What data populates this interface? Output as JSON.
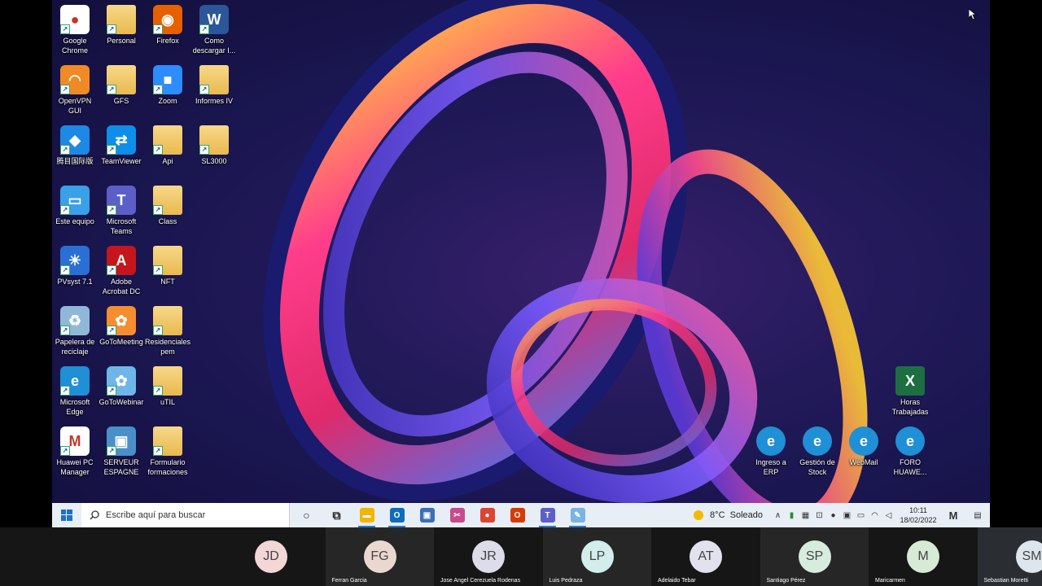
{
  "desktop_icons": [
    {
      "name": "chrome-icon",
      "label": "Google Chrome",
      "col": 0,
      "row": 0,
      "color": "#ffffff",
      "glyph": "●"
    },
    {
      "name": "folder-icon",
      "label": "Personal",
      "col": 1,
      "row": 0,
      "folder": true
    },
    {
      "name": "firefox-icon",
      "label": "Firefox",
      "col": 2,
      "row": 0,
      "color": "#e66000",
      "glyph": "◉"
    },
    {
      "name": "word-doc-icon",
      "label": "Como descargar I...",
      "col": 3,
      "row": 0,
      "color": "#2b579a",
      "glyph": "W"
    },
    {
      "name": "openvpn-icon",
      "label": "OpenVPN GUI",
      "col": 0,
      "row": 1,
      "color": "#f08a24",
      "glyph": "◠"
    },
    {
      "name": "folder-icon",
      "label": "GFS",
      "col": 1,
      "row": 1,
      "folder": true
    },
    {
      "name": "zoom-icon",
      "label": "Zoom",
      "col": 2,
      "row": 1,
      "color": "#2d8cff",
      "glyph": "■"
    },
    {
      "name": "folder-icon",
      "label": "Informes IV",
      "col": 3,
      "row": 1,
      "folder": true
    },
    {
      "name": "app-icon",
      "label": "腾目国际版",
      "col": 0,
      "row": 2,
      "color": "#1e88e5",
      "glyph": "◆"
    },
    {
      "name": "teamviewer-icon",
      "label": "TeamViewer",
      "col": 1,
      "row": 2,
      "color": "#0e8ee9",
      "glyph": "⇄"
    },
    {
      "name": "folder-icon",
      "label": "Api",
      "col": 2,
      "row": 2,
      "folder": true
    },
    {
      "name": "folder-icon",
      "label": "SL3000",
      "col": 3,
      "row": 2,
      "folder": true
    },
    {
      "name": "computer-icon",
      "label": "Este equipo",
      "col": 0,
      "row": 3,
      "color": "#3aa0e8",
      "glyph": "▭"
    },
    {
      "name": "teams-icon",
      "label": "Microsoft Teams",
      "col": 1,
      "row": 3,
      "color": "#5b5fc7",
      "glyph": "T"
    },
    {
      "name": "folder-icon",
      "label": "Class",
      "col": 2,
      "row": 3,
      "folder": true
    },
    {
      "name": "pvsyst-icon",
      "label": "PVsyst 7.1",
      "col": 0,
      "row": 4,
      "color": "#2a6fd6",
      "glyph": "☀"
    },
    {
      "name": "acrobat-icon",
      "label": "Adobe Acrobat DC",
      "col": 1,
      "row": 4,
      "color": "#c4161c",
      "glyph": "A"
    },
    {
      "name": "folder-icon",
      "label": "NFT",
      "col": 2,
      "row": 4,
      "folder": true
    },
    {
      "name": "recycle-bin-icon",
      "label": "Papelera de reciclaje",
      "col": 0,
      "row": 5,
      "color": "#8fb8d8",
      "glyph": "♻"
    },
    {
      "name": "gotomeeting-icon",
      "label": "GoToMeeting",
      "col": 1,
      "row": 5,
      "color": "#f68d2e",
      "glyph": "✿"
    },
    {
      "name": "folder-icon",
      "label": "Residenciales pem",
      "col": 2,
      "row": 5,
      "folder": true
    },
    {
      "name": "edge-icon",
      "label": "Microsoft Edge",
      "col": 0,
      "row": 6,
      "color": "#1f8fd6",
      "glyph": "e"
    },
    {
      "name": "gotowebinar-icon",
      "label": "GoToWebinar",
      "col": 1,
      "row": 6,
      "color": "#6fb6e8",
      "glyph": "✿"
    },
    {
      "name": "folder-icon",
      "label": "uTIL",
      "col": 2,
      "row": 6,
      "folder": true
    },
    {
      "name": "huawei-pc-manager-icon",
      "label": "Huawei PC Manager",
      "col": 0,
      "row": 7,
      "color": "#ffffff",
      "glyph": "M"
    },
    {
      "name": "network-computer-icon",
      "label": "SERVEUR ESPAGNE",
      "col": 1,
      "row": 7,
      "color": "#4a90c8",
      "glyph": "▣"
    },
    {
      "name": "folder-icon",
      "label": "Formulario formaciones",
      "col": 2,
      "row": 7,
      "folder": true
    }
  ],
  "right_icons": [
    {
      "name": "excel-icon",
      "label": "Horas Trabajadas",
      "color": "#1d6f42",
      "glyph": "X"
    },
    {
      "name": "edge-icon",
      "label": "Ingreso a ERP",
      "color": "#1f8fd6",
      "glyph": "e"
    },
    {
      "name": "edge-icon",
      "label": "Gestión de Stock",
      "color": "#1f8fd6",
      "glyph": "e"
    },
    {
      "name": "edge-icon",
      "label": "WebMail",
      "color": "#1f8fd6",
      "glyph": "e"
    },
    {
      "name": "edge-icon",
      "label": "FORO HUAWE...",
      "color": "#1f8fd6",
      "glyph": "e"
    }
  ],
  "taskbar": {
    "search_placeholder": "Escribe aquí para buscar",
    "apps": [
      {
        "name": "cortana-icon",
        "glyph": "○",
        "color": "transparent",
        "fg": "#222"
      },
      {
        "name": "task-view-icon",
        "glyph": "⧉",
        "color": "transparent",
        "fg": "#222"
      },
      {
        "name": "file-explorer-icon",
        "glyph": "▬",
        "color": "#f2b500",
        "active": true
      },
      {
        "name": "outlook-icon",
        "glyph": "O",
        "color": "#0f6cbd",
        "active": true
      },
      {
        "name": "network-app-icon",
        "glyph": "▣",
        "color": "#3b6fb6"
      },
      {
        "name": "snipping-icon",
        "glyph": "✂",
        "color": "#c84b8d"
      },
      {
        "name": "chrome-icon",
        "glyph": "●",
        "color": "#dd4433"
      },
      {
        "name": "office-icon",
        "glyph": "O",
        "color": "#d83b01"
      },
      {
        "name": "teams-icon",
        "glyph": "T",
        "color": "#5b5fc7",
        "active": true
      },
      {
        "name": "paint-icon",
        "glyph": "✎",
        "color": "#7bb4e0",
        "active": true
      }
    ],
    "weather": "8°C  Soleado",
    "time": "10:11",
    "date": "18/02/2022"
  },
  "participants": [
    {
      "initials": "JD",
      "name": "",
      "bg": "#f3d6d6",
      "tile": "#161616"
    },
    {
      "initials": "FG",
      "name": "Ferran Garcia",
      "bg": "#ead8d0",
      "tile": "#262626"
    },
    {
      "initials": "JR",
      "name": "Jose Angel Cerezuela Rodenas",
      "bg": "#dcdcea",
      "tile": "#161616"
    },
    {
      "initials": "LP",
      "name": "Luis Pedraza",
      "bg": "#d3ecec",
      "tile": "#262626"
    },
    {
      "initials": "AT",
      "name": "Adelaido Tebar",
      "bg": "#e2e2ee",
      "tile": "#161616"
    },
    {
      "initials": "SP",
      "name": "Santiago Pérez",
      "bg": "#d6ecdc",
      "tile": "#262626"
    },
    {
      "initials": "M",
      "name": "Maricarmen",
      "bg": "#d6ead6",
      "tile": "#161616"
    },
    {
      "initials": "SM",
      "name": "Sebastian Moretti",
      "bg": "#dde6ec",
      "tile": "#2a2e33"
    }
  ]
}
